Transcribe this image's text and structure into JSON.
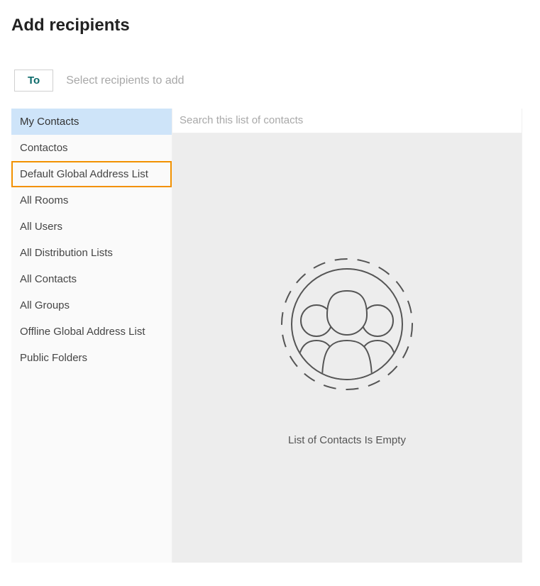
{
  "header": {
    "title": "Add recipients"
  },
  "recipient_bar": {
    "to_label": "To",
    "placeholder": "Select recipients to add"
  },
  "sidebar": {
    "items": [
      {
        "label": "My Contacts",
        "selected": true,
        "highlighted": false
      },
      {
        "label": "Contactos",
        "selected": false,
        "highlighted": false
      },
      {
        "label": "Default Global Address List",
        "selected": false,
        "highlighted": true
      },
      {
        "label": "All Rooms",
        "selected": false,
        "highlighted": false
      },
      {
        "label": "All Users",
        "selected": false,
        "highlighted": false
      },
      {
        "label": "All Distribution Lists",
        "selected": false,
        "highlighted": false
      },
      {
        "label": "All Contacts",
        "selected": false,
        "highlighted": false
      },
      {
        "label": "All Groups",
        "selected": false,
        "highlighted": false
      },
      {
        "label": "Offline Global Address List",
        "selected": false,
        "highlighted": false
      },
      {
        "label": "Public Folders",
        "selected": false,
        "highlighted": false
      }
    ]
  },
  "main": {
    "search_placeholder": "Search this list of contacts",
    "empty_message": "List of Contacts Is Empty"
  }
}
